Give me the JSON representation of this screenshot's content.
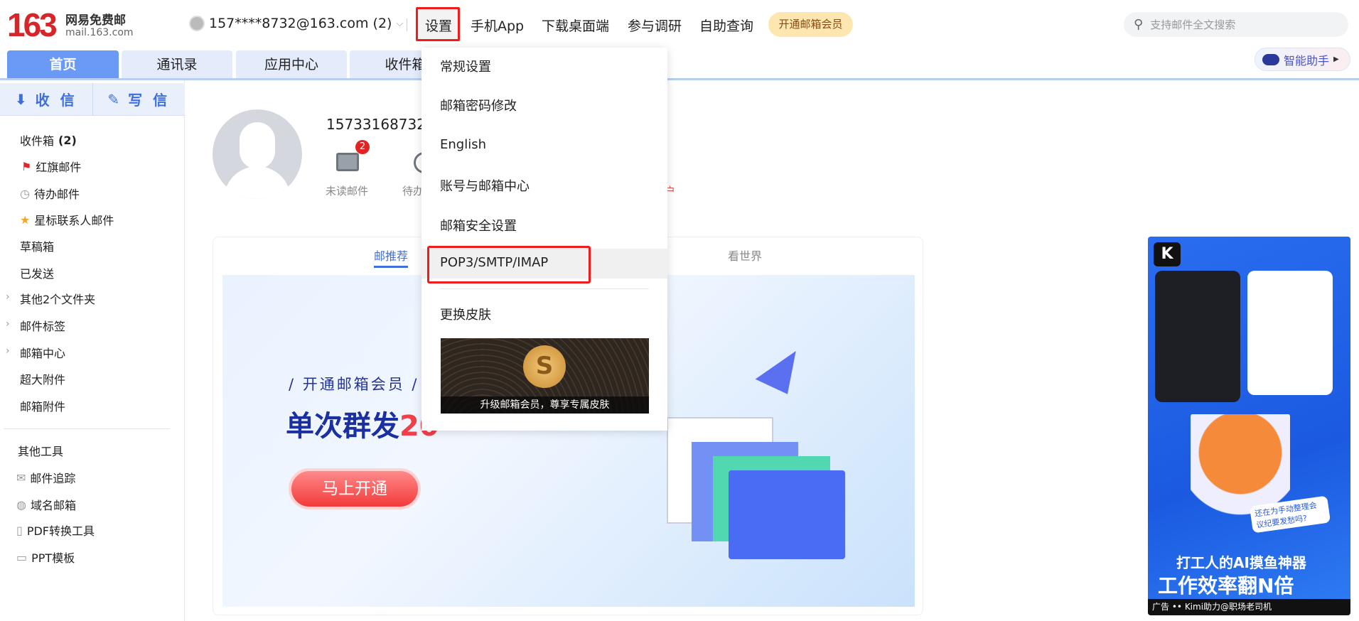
{
  "header": {
    "logo_number": "163",
    "logo_name": "网易免费邮",
    "logo_url": "mail.163.com",
    "account": "157****8732@163.com (2)",
    "nav": [
      "设置",
      "手机App",
      "下载桌面端",
      "参与调研",
      "自助查询"
    ],
    "vip_button": "开通邮箱会员",
    "search_placeholder": "支持邮件全文搜索",
    "assistant": "智能助手"
  },
  "tabs": [
    "首页",
    "通讯录",
    "应用中心",
    "收件箱"
  ],
  "sidebar": {
    "receive": "收 信",
    "compose": "写 信",
    "folders": [
      {
        "label": "收件箱",
        "count": "(2)"
      },
      {
        "label": "红旗邮件",
        "icon": "red-flag-icon"
      },
      {
        "label": "待办邮件",
        "icon": "clock-icon"
      },
      {
        "label": "星标联系人邮件",
        "icon": "star-icon"
      },
      {
        "label": "草稿箱"
      },
      {
        "label": "已发送"
      },
      {
        "label": "其他2个文件夹",
        "expandable": true
      },
      {
        "label": "邮件标签",
        "expandable": true
      },
      {
        "label": "邮箱中心",
        "expandable": true
      },
      {
        "label": "超大附件"
      },
      {
        "label": "邮箱附件"
      }
    ],
    "tools_title": "其他工具",
    "tools": [
      {
        "label": "邮件追踪",
        "icon": "mail-track-icon"
      },
      {
        "label": "域名邮箱",
        "icon": "globe-icon"
      },
      {
        "label": "PDF转换工具",
        "icon": "pdf-icon"
      },
      {
        "label": "PPT模板",
        "icon": "image-icon"
      }
    ]
  },
  "profile": {
    "username": "15733168732",
    "unread_label": "未读邮件",
    "unread_count": "2",
    "todo_label": "待办邮件",
    "fragment": "户"
  },
  "card": {
    "tabs": [
      "邮推荐",
      "看世界"
    ],
    "banner_sub": "/ 开通邮箱会员 /",
    "banner_title_a": "单次群发",
    "banner_title_b": "20",
    "banner_button": "马上开通"
  },
  "dropdown": {
    "items": [
      "常规设置",
      "邮箱密码修改",
      "English",
      "账号与邮箱中心",
      "邮箱安全设置",
      "POP3/SMTP/IMAP",
      "更换皮肤"
    ],
    "skin_caption": "升级邮箱会员，尊享专属皮肤"
  },
  "ad": {
    "line1": "打工人的AI摸鱼神器",
    "line2": "工作效率翻N倍",
    "bubble": "还在为手动整理会议纪要发愁吗?",
    "label": "广告",
    "footer": "Kimi助力@职场老司机"
  },
  "colors": {
    "accent": "#6a9af5",
    "highlight": "#f21b1b",
    "brand": "#d6262a"
  }
}
